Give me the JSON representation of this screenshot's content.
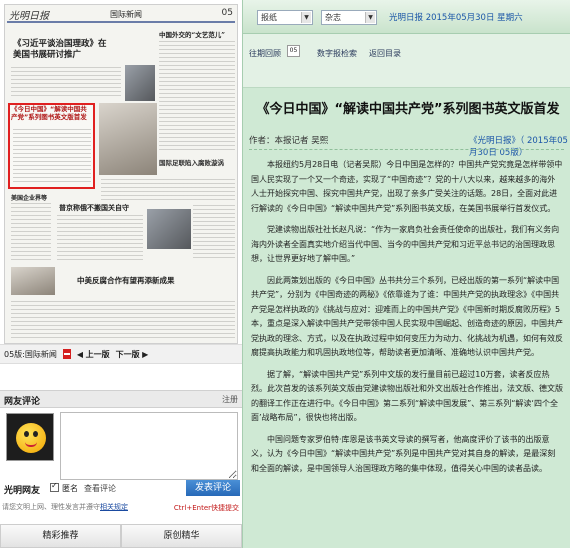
{
  "newspaper": {
    "masthead": "光明日报",
    "section": "国际新闻",
    "page_no": "05",
    "headline_main": "《习近平谈治国理政》在美国书展研讨推广",
    "headline_right": "中国外交的“文艺范儿”",
    "highlight_headline": "《今日中国》“解读中国共产党”系列图书英文版首发",
    "headline_mid": "国际足联陷入腐败漩涡",
    "headline_bottom_left": "美国企业界等",
    "headline_bottom_center": "普京称俄不搬国关自守",
    "headline_bottom_right": "中美反腐合作有望再添新成果"
  },
  "page_nav": {
    "page": "05版:国际新闻",
    "prev": "上一版",
    "next": "下一版"
  },
  "comments": {
    "title": "网友评论",
    "register": "注册",
    "nickname": "光明网友",
    "anonymous_label": "匿名",
    "view_comments": "查看评论",
    "submit": "发表评论",
    "rules_prefix": "请您文明上网、理性发言并遵守",
    "rules_link": "相关规定",
    "shortcut": "Ctrl+Enter快捷提交",
    "tab_recommended": "精彩推荐",
    "tab_original": "原创精华"
  },
  "topbar": {
    "select_newspaper": "报纸",
    "select_magazine": "杂志",
    "date_text": "光明日报 2015年05月30日 星期六"
  },
  "subnav": {
    "back": "往期回顾",
    "digital_search": "数字报检索",
    "back_home": "返回目录",
    "page_select": "05"
  },
  "article": {
    "title": "《今日中国》“解读中国共产党”系列图书英文版首发",
    "author_label": "作者：",
    "author": "本报记者 吴熙",
    "source": "《光明日报》",
    "date": "（ 2015年05月30日 05版）",
    "paragraphs": [
      "本报纽约5月28日电（记者吴熙）今日中国是怎样的？中国共产党究竟是怎样带领中国人民实现了一个又一个奇迹，实现了“中国奇迹”？党的十八大以来，越来越多的海外人士开始探究中国、探究中国共产党，出现了亲多广受关注的话题。28日，全面对此进行解读的《今日中国》“解读中国共产党”系列图书英文版，在美国书展举行首发仪式。",
      "党建读物出版社社长赵凡说：“作为一家肩负社会责任使命的出版社，我们有义务向海内外读者全面真实地介绍当代中国、当今的中国共产党和习近平总书记的治国理政思想，让世界更好地了解中国。”",
      "因此两策划出版的《今日中国》丛书共分三个系列，已经出版的第一系列“解读中国共产党”，分别为《中国奇迹的两秘》《依靠谁为了谁：中国共产党的执政理念》《中国共产党是怎样执政的》《挑战与应对：迎难而上的中国共产党》《中国新时期反腐败历程》5本，重点是深入解读中国共产党带领中国人民实现中国崛起、创造奇迹的原因，中国共产党执政的理念、方式，以及在执政过程中如何变压力为动力、化挑战为机遇，如何有效反腐提高执政能力和巩固执政地位等，帮助读者更加清晰、准确地认识中国共产党。",
      "据了解，“解读中国共产党”系列中文版的发行量目前已超过10万套，读者反应热烈。此次首发的该系列英文版由党建读物出版社和外文出版社合作推出，法文版、德文版的翻译工作正在进行中。《今日中国》第二系列“解读中国发展”、第三系列“解读‘四个全面’战略布局”，很快也将出版。",
      "中国问题专家罗伯特·库恩是该书英文导读的撰写者，他高度评价了该书的出版意义，认为《今日中国》“解读中国共产党”系列是中国共产党对其自身的解读，是最深刻和全面的解读，是中国领导人治国理政方略的集中体现，值得关心中国的读者品读。"
    ]
  }
}
